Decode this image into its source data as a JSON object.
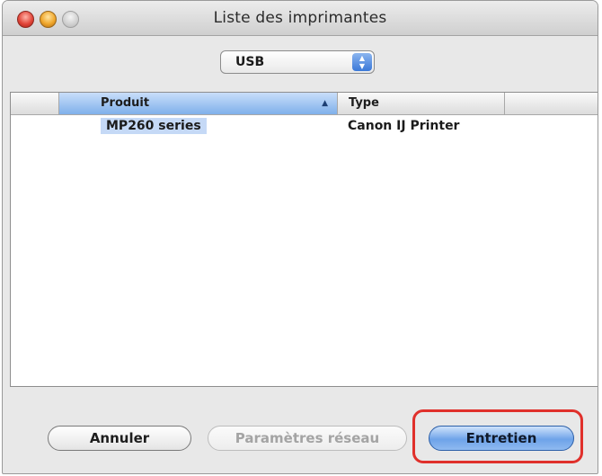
{
  "window": {
    "title": "Liste des imprimantes"
  },
  "connection_popup": {
    "selected": "USB"
  },
  "printer_table": {
    "columns": [
      "Produit",
      "Type"
    ],
    "sort_column": "Produit",
    "sort_direction": "ascending",
    "rows": [
      {
        "produit": "MP260 series",
        "type": "Canon IJ Printer",
        "selected": true
      }
    ]
  },
  "buttons": {
    "cancel": "Annuler",
    "network_settings": "Paramètres réseau",
    "network_settings_enabled": false,
    "maintenance": "Entretien"
  },
  "colors": {
    "selection": "#c5d9f6",
    "default_button": "#6ea3e9",
    "highlight_ring": "#e0302b"
  }
}
